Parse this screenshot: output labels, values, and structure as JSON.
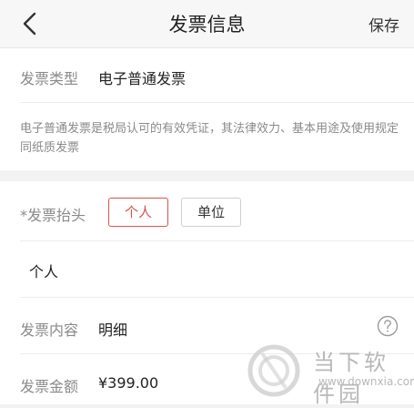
{
  "nav": {
    "back_icon": "chevron-left-icon",
    "title": "发票信息",
    "save_label": "保存"
  },
  "invoice_type": {
    "label": "发票类型",
    "value": "电子普通发票",
    "description": "电子普通发票是税局认可的有效凭证，其法律效力、基本用途及使用规定同纸质发票"
  },
  "invoice_header": {
    "label": "*发票抬头",
    "options": [
      {
        "label": "个人",
        "selected": true
      },
      {
        "label": "单位",
        "selected": false
      }
    ],
    "name_value": "个人"
  },
  "invoice_content": {
    "label": "发票内容",
    "value": "明细",
    "help_icon": "question-circle-icon"
  },
  "invoice_amount": {
    "label": "发票金额",
    "value": "¥399.00"
  },
  "watermark": {
    "text": "当下软件园",
    "url": "www.downxia.com"
  },
  "colors": {
    "accent": "#d9534f",
    "label": "#8a8a8a",
    "background": "#f2f2f2"
  }
}
